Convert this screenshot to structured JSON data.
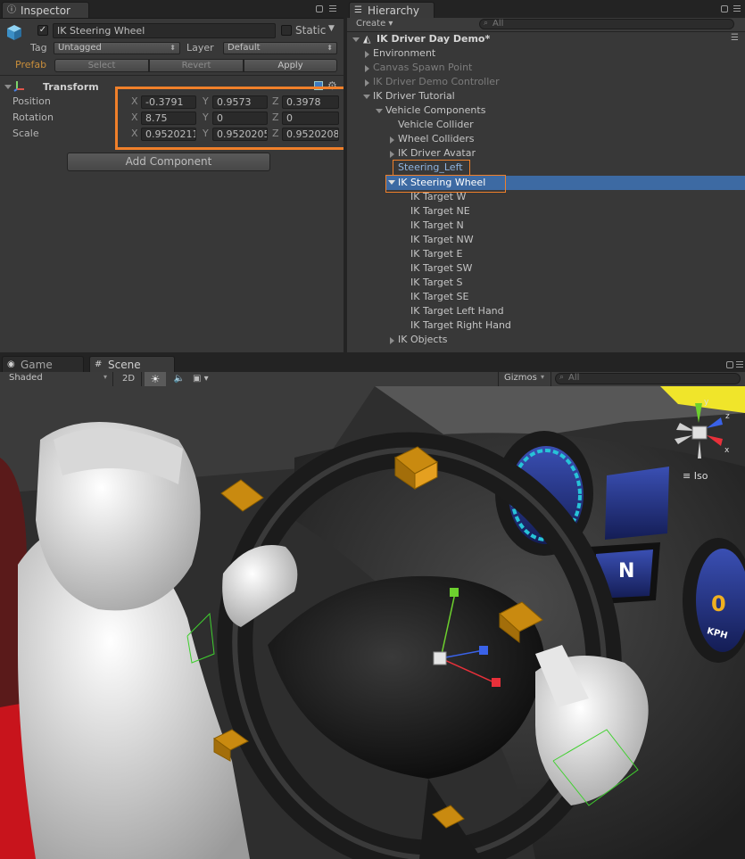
{
  "inspector": {
    "tab_label": "Inspector",
    "object_name": "IK Steering Wheel",
    "static_label": "Static",
    "tag_label": "Tag",
    "tag_value": "Untagged",
    "layer_label": "Layer",
    "layer_value": "Default",
    "prefab_label": "Prefab",
    "prefab_select": "Select",
    "prefab_revert": "Revert",
    "prefab_apply": "Apply",
    "transform_title": "Transform",
    "rows": {
      "position": {
        "label": "Position",
        "x": "-0.3791",
        "y": "0.9573",
        "z": "0.3978"
      },
      "rotation": {
        "label": "Rotation",
        "x": "8.75",
        "y": "0",
        "z": "0"
      },
      "scale": {
        "label": "Scale",
        "x": "0.9520211",
        "y": "0.9520205",
        "z": "0.9520208"
      }
    },
    "axis_x": "X",
    "axis_y": "Y",
    "axis_z": "Z",
    "add_component": "Add Component"
  },
  "hierarchy": {
    "tab_label": "Hierarchy",
    "create_label": "Create",
    "search_placeholder": "All",
    "scene_name": "IK Driver Day Demo*",
    "items": [
      {
        "label": "Environment"
      },
      {
        "label": "Canvas Spawn Point"
      },
      {
        "label": "IK Driver Demo Controller"
      },
      {
        "label": "IK Driver Tutorial"
      },
      {
        "label": "Vehicle Components"
      },
      {
        "label": "Vehicle Collider"
      },
      {
        "label": "Wheel Colliders"
      },
      {
        "label": "IK Driver Avatar"
      },
      {
        "label": "Steering_Left"
      },
      {
        "label": "IK Steering Wheel"
      },
      {
        "label": "IK Target W"
      },
      {
        "label": "IK Target NE"
      },
      {
        "label": "IK Target N"
      },
      {
        "label": "IK Target NW"
      },
      {
        "label": "IK Target E"
      },
      {
        "label": "IK Target SW"
      },
      {
        "label": "IK Target S"
      },
      {
        "label": "IK Target SE"
      },
      {
        "label": "IK Target Left Hand"
      },
      {
        "label": "IK Target Right Hand"
      },
      {
        "label": "IK Objects"
      }
    ]
  },
  "scene": {
    "game_tab": "Game",
    "scene_tab": "Scene",
    "shaded_label": "Shaded",
    "mode_2d": "2D",
    "gizmos_label": "Gizmos",
    "search_placeholder": "All",
    "iso_label": "Iso",
    "gear_letter": "N",
    "speed_value": "0",
    "speed_unit": "KPH",
    "axis_labels": {
      "y": "y",
      "z": "z",
      "x": "x"
    }
  },
  "colors": {
    "highlight_orange": "#f0802a",
    "selection_blue": "#3d6aa3",
    "panel_bg": "#383838"
  }
}
